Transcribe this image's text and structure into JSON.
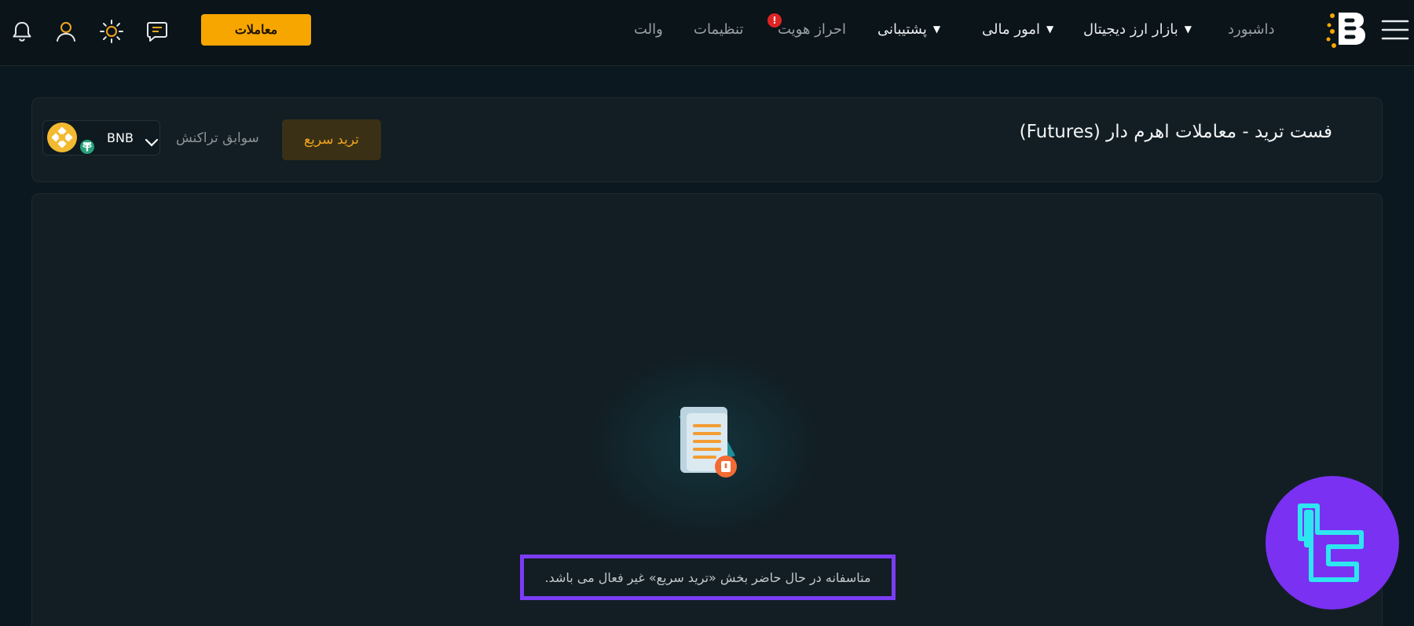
{
  "header": {
    "trade_button_label": "معاملات",
    "nav": {
      "dashboard": "داشبورد",
      "digital_market": "بازار ارز دیجیتال",
      "financial": "امور مالی",
      "support": "پشتیبانی",
      "verification": "احراز هویت",
      "verification_badge": "!",
      "settings": "تنظیمات",
      "wallet": "والت"
    },
    "icons": [
      "bell-icon",
      "user-icon",
      "sun-icon",
      "chat-icon",
      "menu-icon"
    ],
    "accent_color": "#f7a600",
    "alert_color": "#e02424"
  },
  "toolbar": {
    "page_title": "فست ترید - معاملات اهرم دار (Futures)",
    "fast_trade_label": "ترید سریع",
    "history_label": "سوابق تراکنش",
    "pair": {
      "symbol": "BNB",
      "base_icon": "bnb-coin-icon",
      "quote_icon": "tether-coin-icon"
    }
  },
  "content": {
    "empty_icon": "document-warning-icon",
    "message": "متاسفانه در حال حاضر بخش «ترید سریع» غیر فعال می باشد.",
    "highlight_color": "#7b3cf5"
  },
  "watermark": {
    "icon": "brand-logo-icon",
    "color": "#7a31f2"
  }
}
